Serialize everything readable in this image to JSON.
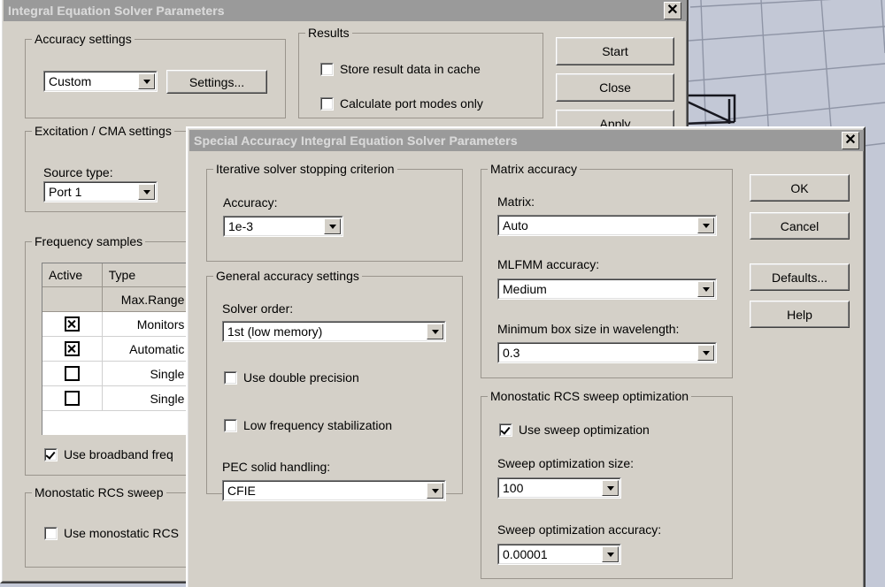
{
  "viewport": {
    "name": "3d-model-viewport",
    "background_color": "#c3c8d6",
    "grid_color": "#8f95a6"
  },
  "dialog1": {
    "title": "Integral Equation Solver Parameters",
    "close_label": "✕",
    "accuracy_group": {
      "title": "Accuracy settings",
      "accuracy_value": "Custom",
      "settings_button": "Settings..."
    },
    "results_group": {
      "title": "Results",
      "checkboxes": [
        {
          "label": "Store result data in cache",
          "checked": false
        },
        {
          "label": "Calculate port modes only",
          "checked": false
        }
      ]
    },
    "buttons": [
      {
        "label": "Start"
      },
      {
        "label": "Close"
      },
      {
        "label": "Apply"
      }
    ],
    "excitation_group": {
      "title": "Excitation / CMA settings",
      "source_type_label": "Source type:",
      "source_type_value": "Port 1"
    },
    "frequency_group": {
      "title": "Frequency samples",
      "columns": [
        "Active",
        "Type"
      ],
      "subheader": [
        "",
        "Max.Range"
      ],
      "rows": [
        {
          "active": "x",
          "type": "Monitors"
        },
        {
          "active": "x",
          "type": "Automatic"
        },
        {
          "active": "",
          "type": "Single"
        },
        {
          "active": "",
          "type": "Single"
        }
      ],
      "broadband_checkbox": {
        "label": "Use broadband freq",
        "checked": true
      }
    },
    "monostatic_group": {
      "title": "Monostatic RCS sweep",
      "checkbox": {
        "label": "Use monostatic RCS",
        "checked": false
      }
    }
  },
  "dialog2": {
    "title": "Special Accuracy Integral Equation Solver Parameters",
    "close_label": "✕",
    "iterative_group": {
      "title": "Iterative solver stopping criterion",
      "accuracy_label": "Accuracy:",
      "accuracy_value": "1e-3"
    },
    "general_group": {
      "title": "General accuracy settings",
      "solver_order_label": "Solver order:",
      "solver_order_value": "1st (low memory)",
      "double_precision": {
        "label": "Use double precision",
        "checked": false
      },
      "low_freq_stab": {
        "label": "Low frequency stabilization",
        "checked": false
      },
      "pec_label": "PEC solid handling:",
      "pec_value": "CFIE"
    },
    "matrix_group": {
      "title": "Matrix accuracy",
      "matrix_label": "Matrix:",
      "matrix_value": "Auto",
      "mlfmm_label": "MLFMM accuracy:",
      "mlfmm_value": "Medium",
      "minbox_label": "Minimum box size in wavelength:",
      "minbox_value": "0.3"
    },
    "rcs_group": {
      "title": "Monostatic RCS sweep optimization",
      "use_sweep": {
        "label": "Use sweep optimization",
        "checked": true
      },
      "size_label": "Sweep optimization size:",
      "size_value": "100",
      "accuracy_label": "Sweep optimization accuracy:",
      "accuracy_value": "0.00001"
    },
    "buttons": [
      {
        "label": "OK"
      },
      {
        "label": "Cancel"
      },
      {
        "label": "Defaults..."
      },
      {
        "label": "Help"
      }
    ]
  }
}
